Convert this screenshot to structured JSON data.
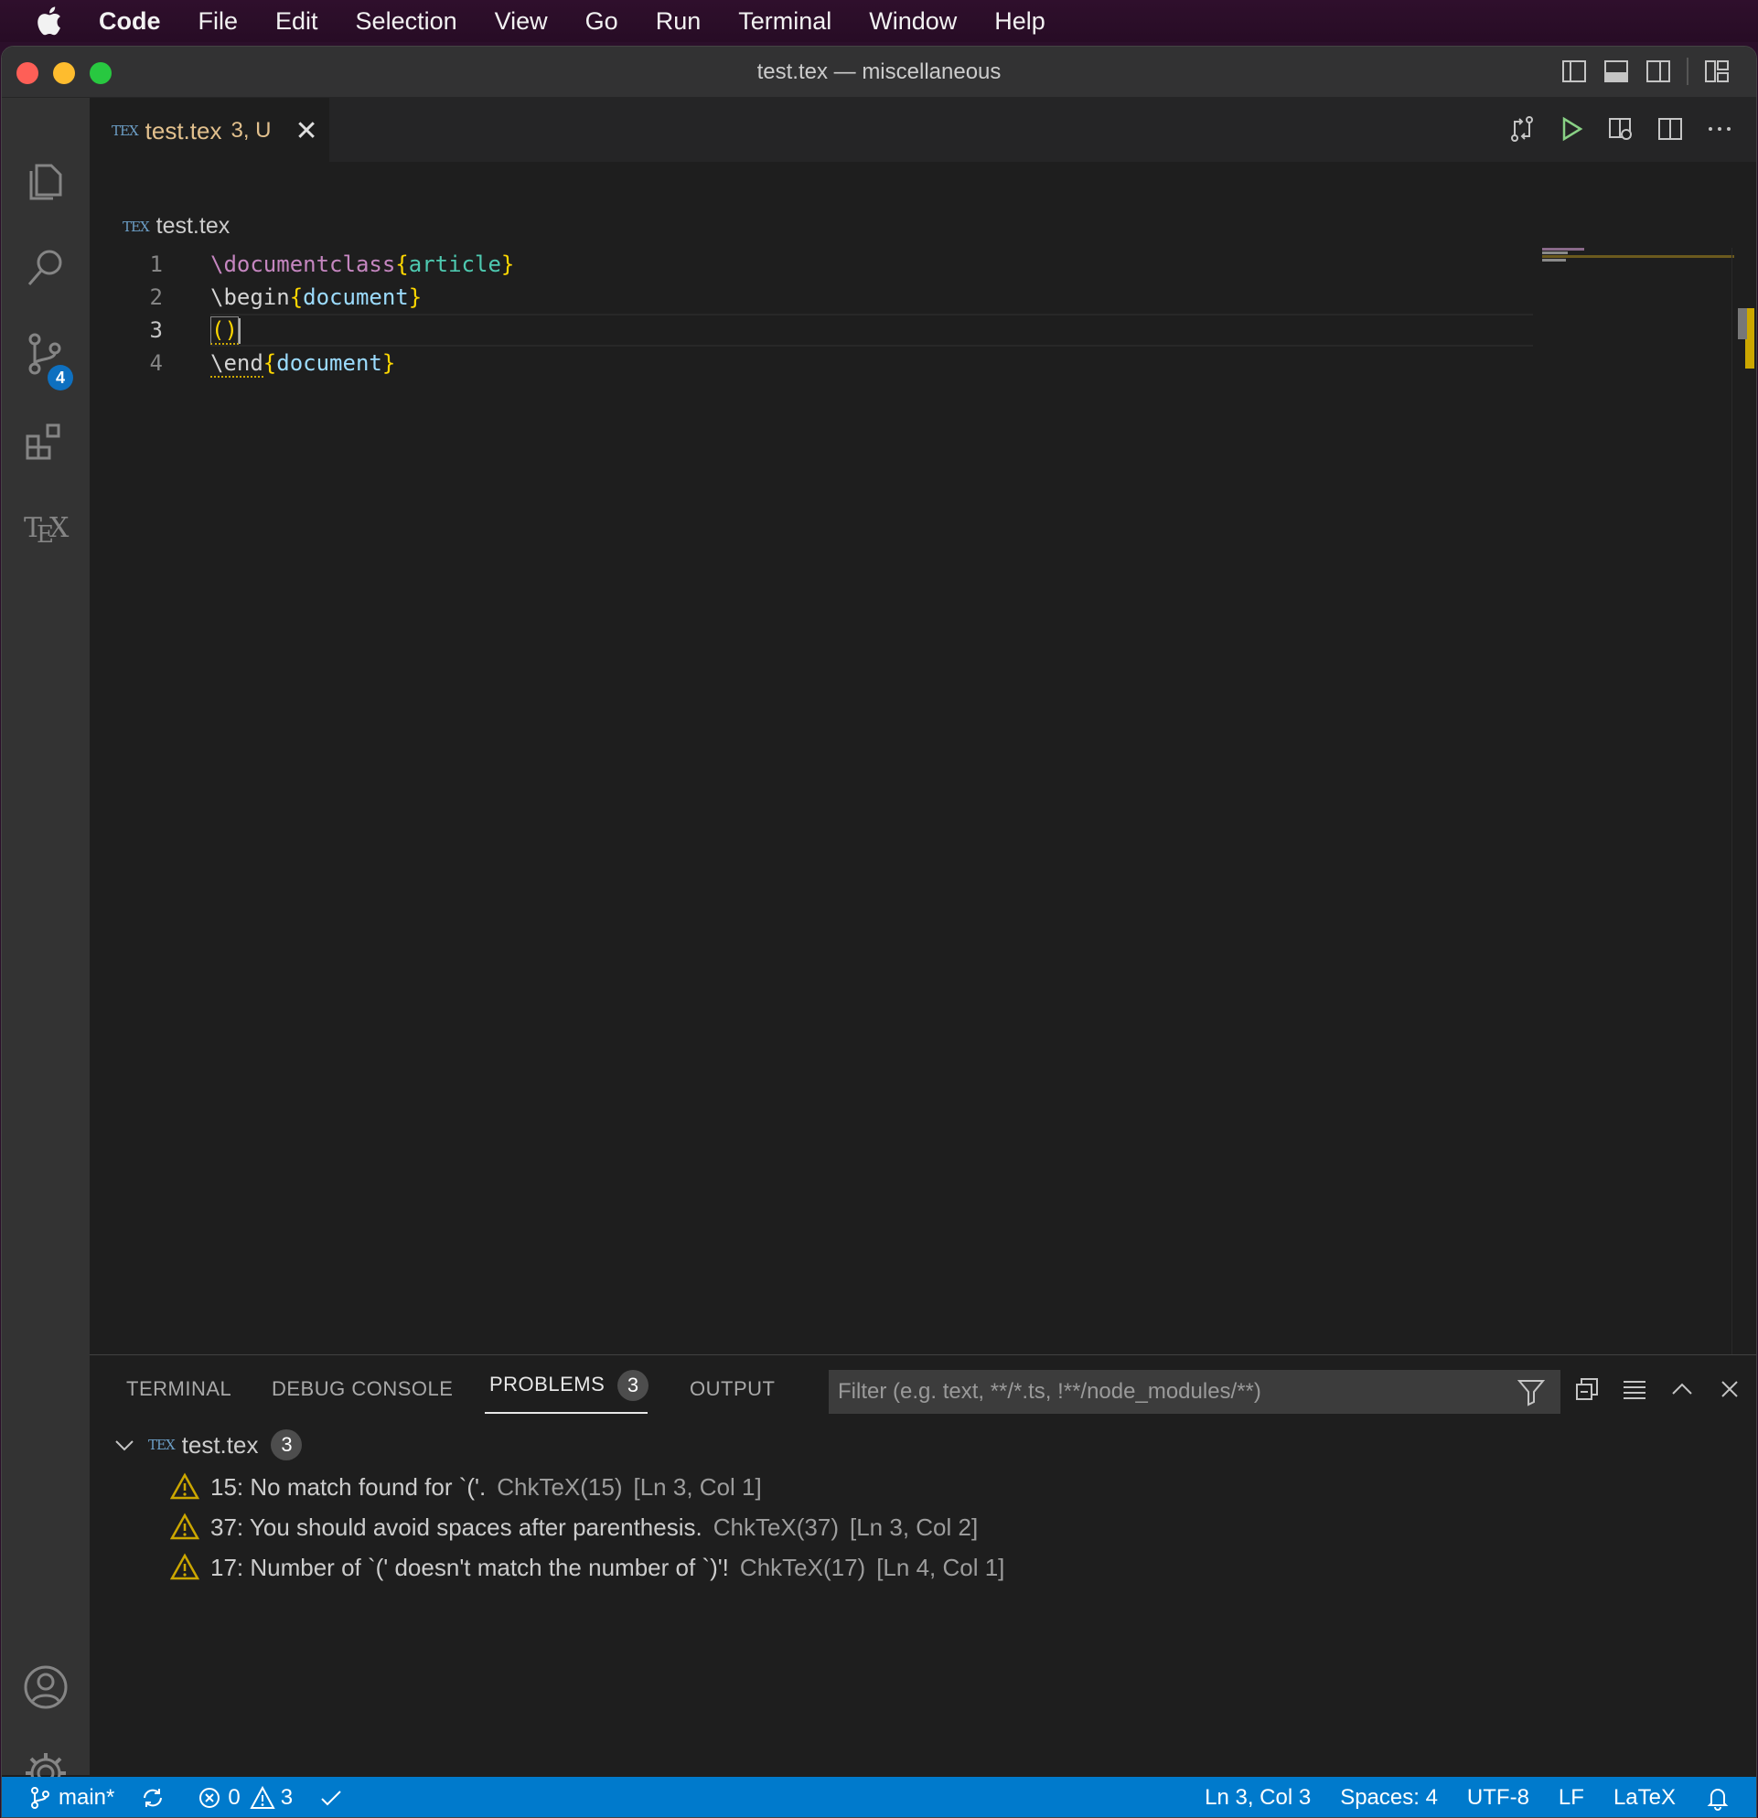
{
  "menubar": {
    "app": "Code",
    "items": [
      "File",
      "Edit",
      "Selection",
      "View",
      "Go",
      "Run",
      "Terminal",
      "Window",
      "Help"
    ]
  },
  "window": {
    "title": "test.tex — miscellaneous"
  },
  "activity": {
    "source_control_badge": "4"
  },
  "tab": {
    "file_icon": "TEX",
    "name": "test.tex",
    "status": "3, U"
  },
  "breadcrumb": {
    "file": "test.tex"
  },
  "editor": {
    "line_numbers": [
      "1",
      "2",
      "3",
      "4"
    ],
    "lines": {
      "l1_cmd": "\\documentclass",
      "l1_arg": "article",
      "l2_cmd": "\\begin",
      "l2_arg": "document",
      "l3_text": "()",
      "l4_cmd": "\\end",
      "l4_arg": "document",
      "open_brace": "{",
      "close_brace": "}"
    }
  },
  "panel": {
    "tabs": [
      "TERMINAL",
      "DEBUG CONSOLE",
      "PROBLEMS",
      "OUTPUT"
    ],
    "problems_count": "3",
    "filter_placeholder": "Filter (e.g. text, **/*.ts, !**/node_modules/**)",
    "group": {
      "file": "test.tex",
      "count": "3"
    },
    "problems": [
      {
        "message": "15: No match found for `('.",
        "source": "ChkTeX(15)",
        "location": "[Ln 3, Col 1]"
      },
      {
        "message": "37: You should avoid spaces after parenthesis.",
        "source": "ChkTeX(37)",
        "location": "[Ln 3, Col 2]"
      },
      {
        "message": "17: Number of `(' doesn't match the number of `)'!",
        "source": "ChkTeX(17)",
        "location": "[Ln 4, Col 1]"
      }
    ]
  },
  "statusbar": {
    "branch": "main*",
    "errors": "0",
    "warnings": "3",
    "position": "Ln 3, Col 3",
    "spaces": "Spaces: 4",
    "encoding": "UTF-8",
    "eol": "LF",
    "language": "LaTeX"
  },
  "colors": {
    "accent": "#007acc",
    "modified_tab": "#e2c08d",
    "warning": "#cca700",
    "menubar": "#2f0f2c"
  }
}
